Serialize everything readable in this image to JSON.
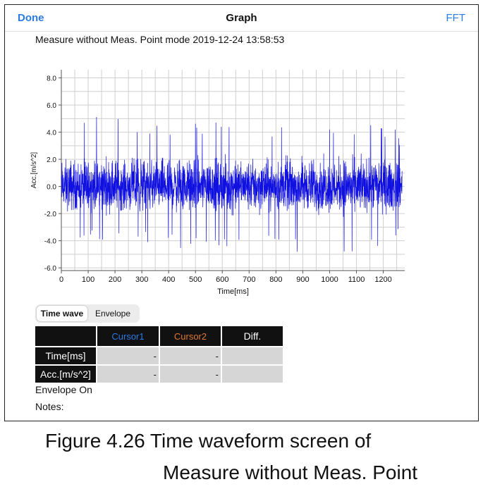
{
  "navbar": {
    "done_label": "Done",
    "title": "Graph",
    "fft_label": "FFT"
  },
  "measurement_title": "Measure without Meas. Point mode  2019-12-24 13:58:53",
  "chart_data": {
    "type": "line",
    "title": "",
    "xlabel": "Time[ms]",
    "ylabel": "Acc.[m/s^2]",
    "xlim": [
      0,
      1280
    ],
    "ylim": [
      -6.2,
      8.6
    ],
    "x_ticks": [
      0,
      100,
      200,
      300,
      400,
      500,
      600,
      700,
      800,
      900,
      1000,
      1100,
      1200
    ],
    "y_ticks": [
      -6.0,
      -4.0,
      -2.0,
      0.0,
      2.0,
      4.0,
      6.0,
      8.0
    ],
    "y_tick_labels": [
      "-6.0",
      "-4.0",
      "-2.0",
      "0.0",
      "2.0",
      "4.0",
      "6.0",
      "8.0"
    ],
    "grid": true,
    "series": [
      {
        "color": "#1010e0",
        "x": [
          0,
          40,
          80,
          120,
          160,
          200,
          240,
          280,
          320,
          360,
          400,
          440,
          480,
          520,
          560,
          600,
          640,
          680,
          720,
          760,
          800,
          840,
          880,
          920,
          960,
          1000,
          1040,
          1080,
          1120,
          1160,
          1200,
          1240,
          1270
        ],
        "y_max": [
          4.7,
          5.2,
          4.6,
          5.5,
          5.2,
          5.5,
          4.5,
          5.2,
          4.9,
          5.4,
          4.8,
          5.1,
          4.9,
          4.8,
          5.2,
          4.9,
          5.0,
          4.6,
          5.1,
          4.9,
          4.8,
          5.2,
          4.9,
          5.1,
          5.0,
          4.8,
          5.4,
          4.8,
          5.1,
          5.0,
          4.8,
          4.7,
          3.4
        ],
        "y_min": [
          -4.3,
          -4.6,
          -4.4,
          -4.2,
          -4.5,
          -4.8,
          -4.2,
          -4.8,
          -4.3,
          -4.6,
          -4.4,
          -5.0,
          -4.6,
          -4.7,
          -4.4,
          -4.9,
          -4.6,
          -4.5,
          -5.1,
          -4.7,
          -4.8,
          -4.5,
          -4.9,
          -4.6,
          -4.8,
          -4.4,
          -5.0,
          -4.9,
          -4.5,
          -4.6,
          -4.8,
          -4.6,
          -3.5
        ]
      }
    ]
  },
  "tabs": {
    "time_wave": "Time wave",
    "envelope": "Envelope"
  },
  "cursor_table": {
    "headers": [
      "",
      "Cursor1",
      "Cursor2",
      "Diff."
    ],
    "rows": [
      {
        "label": "Time[ms]",
        "values": [
          "-",
          "-",
          ""
        ]
      },
      {
        "label": "Acc.[m/s^2]",
        "values": [
          "-",
          "-",
          ""
        ]
      }
    ],
    "colors": {
      "cursor1": "#2a7be4",
      "cursor2": "#e07830"
    }
  },
  "envelope_status": "Envelope On",
  "notes_label": "Notes:",
  "caption": {
    "line1": "Figure 4.26    Time waveform screen of",
    "line2": "Measure without Meas. Point"
  }
}
